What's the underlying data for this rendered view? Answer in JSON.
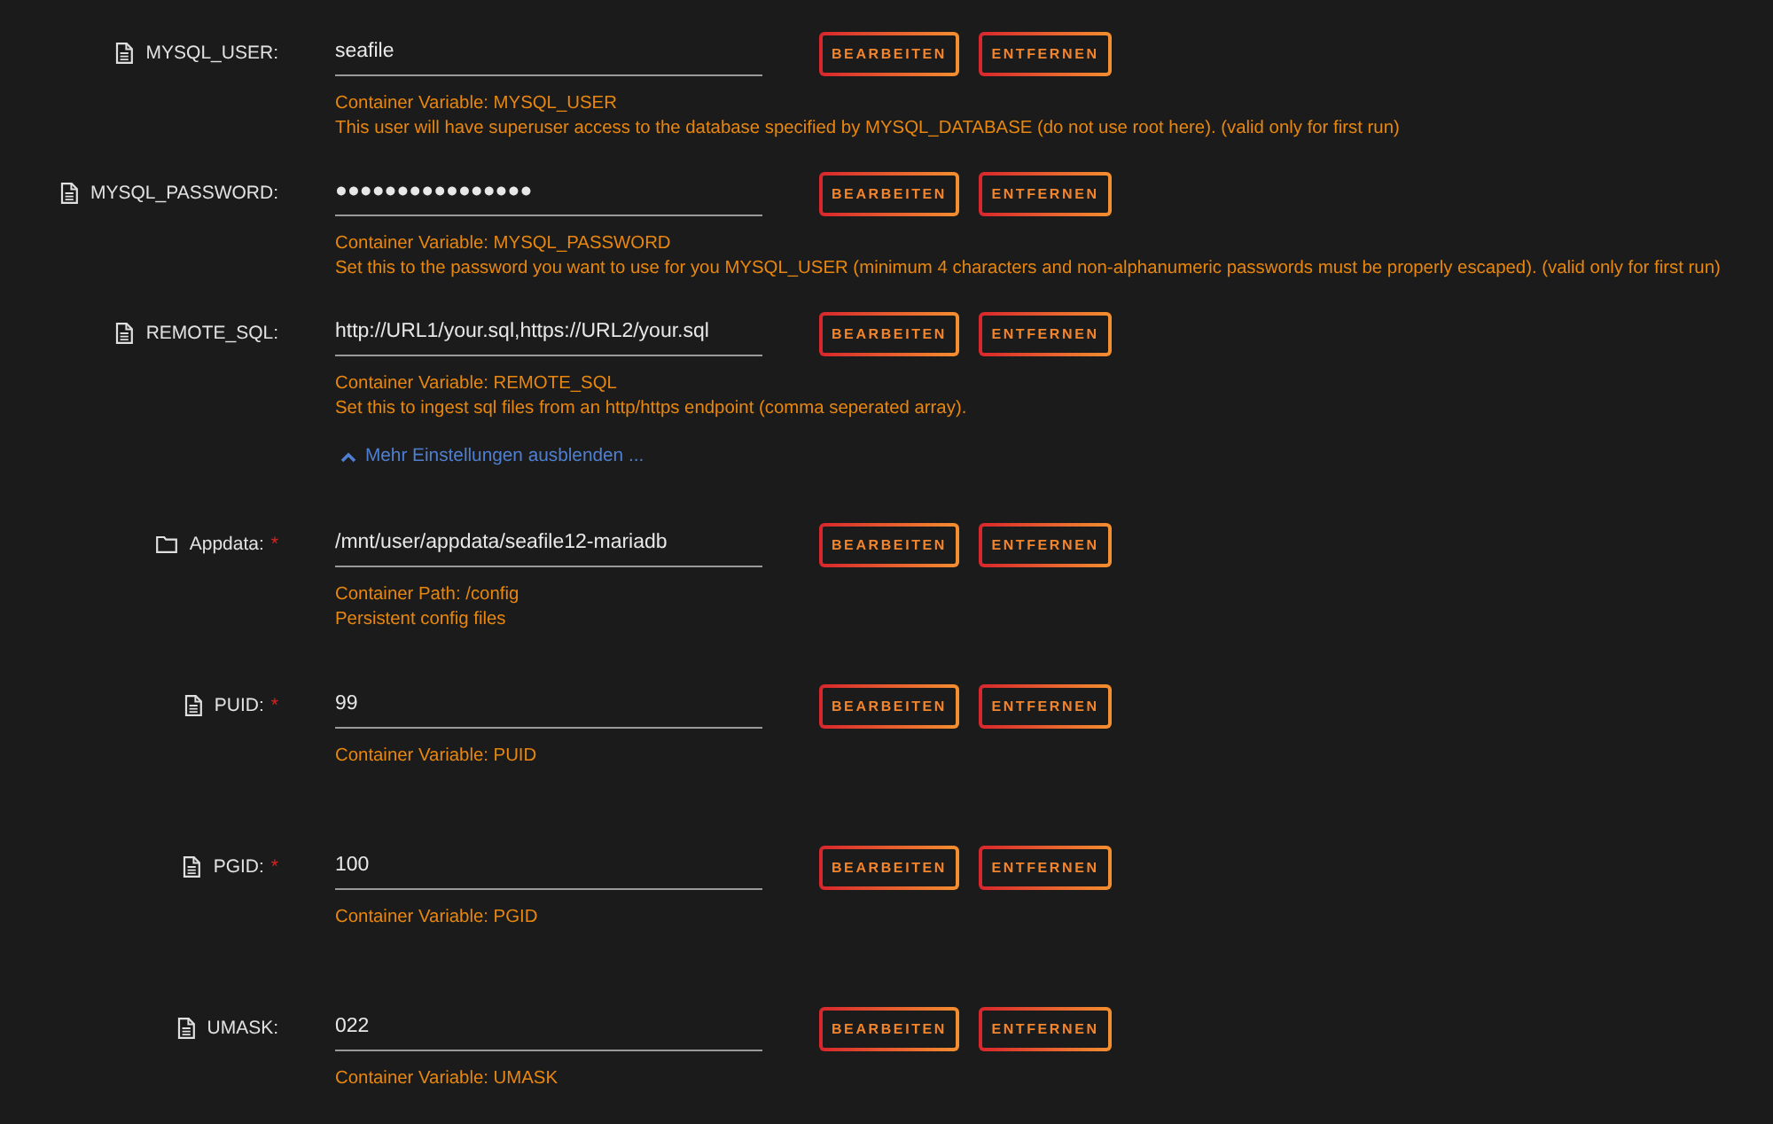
{
  "advanced_settings": [
    {
      "kind": "variable",
      "label": "MYSQL_USER:",
      "value": "seafile",
      "buttons": [
        "BEARBEITEN",
        "ENTFERNEN"
      ],
      "description": [
        "Container Variable: MYSQL_USER",
        "This user will have superuser access to the database specified by MYSQL_DATABASE (do not use root here). (valid only for first run)"
      ]
    },
    {
      "kind": "variable",
      "label": "MYSQL_PASSWORD:",
      "value": "●●●●●●●●●●●●●●●●",
      "buttons": [
        "BEARBEITEN",
        "ENTFERNEN"
      ],
      "description": [
        "Container Variable: MYSQL_PASSWORD",
        "Set this to the password you want to use for you MYSQL_USER (minimum 4 characters and non-alphanumeric passwords must be properly escaped). (valid only for first run)"
      ]
    },
    {
      "kind": "variable",
      "label": "REMOTE_SQL:",
      "value": "http://URL1/your.sql,https://URL2/your.sql",
      "buttons": [
        "BEARBEITEN",
        "ENTFERNEN"
      ],
      "description": [
        "Container Variable: REMOTE_SQL",
        "Set this to ingest sql files from an http/https endpoint (comma seperated array)."
      ]
    }
  ],
  "toggle_link": {
    "label": "Mehr Einstellungen ausblenden ...",
    "expanded": true
  },
  "settings": [
    {
      "kind": "path",
      "label": "Appdata:",
      "required_mark": "*",
      "value": "/mnt/user/appdata/seafile12-mariadb",
      "buttons": [
        "BEARBEITEN",
        "ENTFERNEN"
      ],
      "description": [
        "Container Path: /config",
        "Persistent config files"
      ]
    },
    {
      "kind": "variable",
      "label": "PUID:",
      "required_mark": "*",
      "value": "99",
      "buttons": [
        "BEARBEITEN",
        "ENTFERNEN"
      ],
      "description": [
        "Container Variable: PUID"
      ]
    },
    {
      "kind": "variable",
      "label": "PGID:",
      "required_mark": "*",
      "value": "100",
      "buttons": [
        "BEARBEITEN",
        "ENTFERNEN"
      ],
      "description": [
        "Container Variable: PGID"
      ]
    },
    {
      "kind": "variable",
      "label": "UMASK:",
      "value": "022",
      "buttons": [
        "BEARBEITEN",
        "ENTFERNEN"
      ],
      "description": [
        "Container Variable: UMASK"
      ]
    }
  ]
}
